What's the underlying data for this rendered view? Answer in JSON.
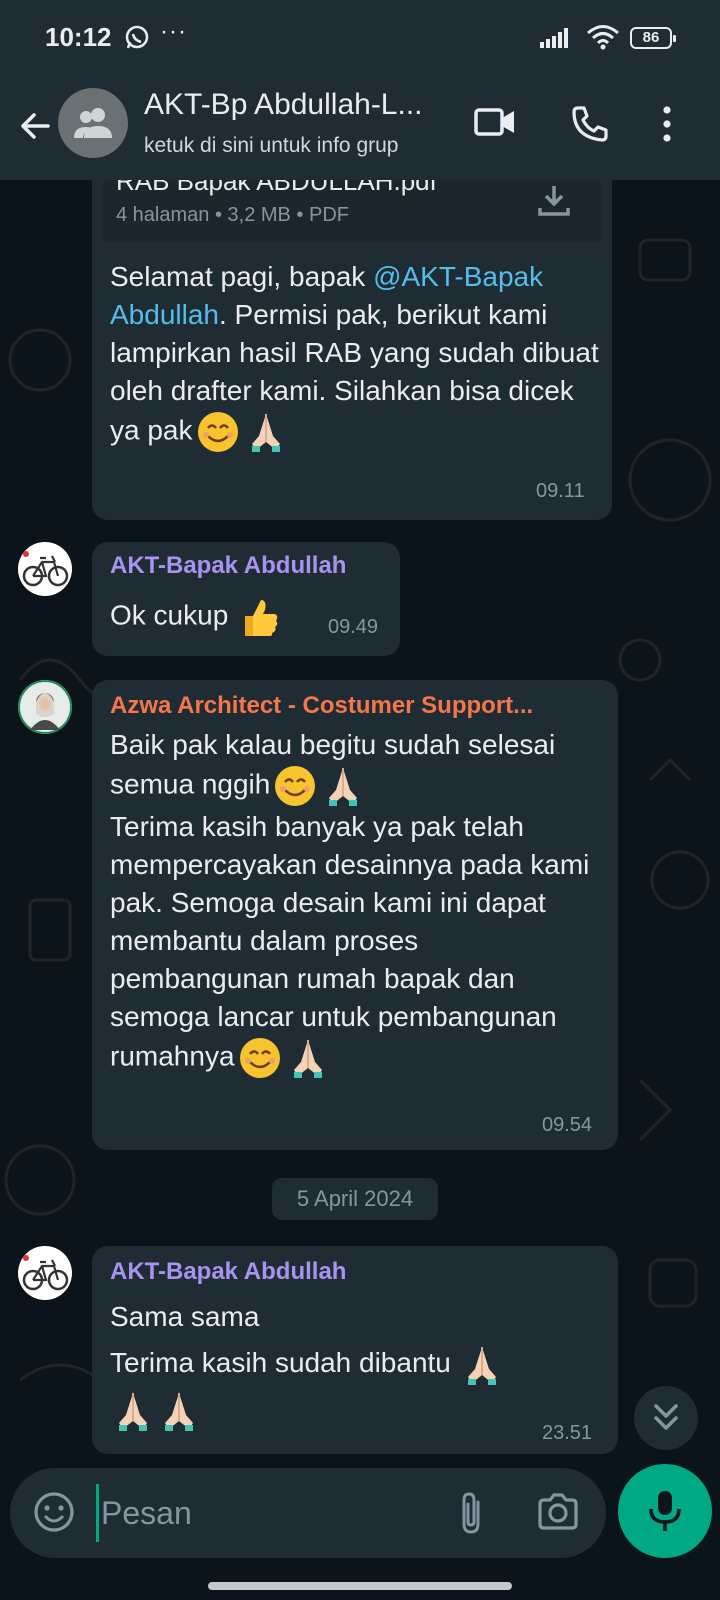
{
  "status_bar": {
    "time": "10:12",
    "overflow": "···",
    "battery": "86"
  },
  "header": {
    "title": "AKT-Bp Abdullah-L...",
    "subtitle": "ketuk di sini untuk info grup",
    "icons": [
      "back-arrow-icon",
      "group-icon",
      "video-call-icon",
      "phone-icon",
      "more-vert-icon"
    ]
  },
  "messages": [
    {
      "file_name": "RAB Bapak ABDULLAH.pdf",
      "file_meta": "4 halaman • 3,2 MB • PDF",
      "text_1": "Selamat pagi, bapak ",
      "mention": "@AKT-Bapak Abdullah",
      "text_2": ". Permisi pak, berikut kami lampirkan hasil RAB yang sudah dibuat oleh drafter kami. Silahkan bisa dicek ya pak",
      "time": "09.11"
    },
    {
      "sender": "AKT-Bapak Abdullah",
      "text": "Ok cukup ",
      "time": "09.49"
    },
    {
      "sender": "Azwa Architect - Costumer Support...",
      "text_1": "Baik pak kalau begitu sudah selesai semua nggih",
      "text_2": "Terima kasih banyak ya pak telah mempercayakan desainnya pada kami pak. Semoga desain kami ini dapat membantu dalam proses pembangunan rumah bapak dan semoga lancar untuk pembangunan rumahnya",
      "time": "09.54"
    },
    {
      "sender": "AKT-Bapak Abdullah",
      "text_1": "Sama sama",
      "text_2": "Terima kasih sudah dibantu ",
      "time": "23.51"
    }
  ],
  "date_divider": "5 April 2024",
  "composer": {
    "placeholder": "Pesan"
  },
  "colors": {
    "background": "#0b141a",
    "bar": "#1f2c33",
    "bubble": "#202c33",
    "accent": "#00a884",
    "mention": "#53bdeb",
    "sender_abdullah": "#a793f0",
    "sender_azwa": "#f5764a"
  }
}
